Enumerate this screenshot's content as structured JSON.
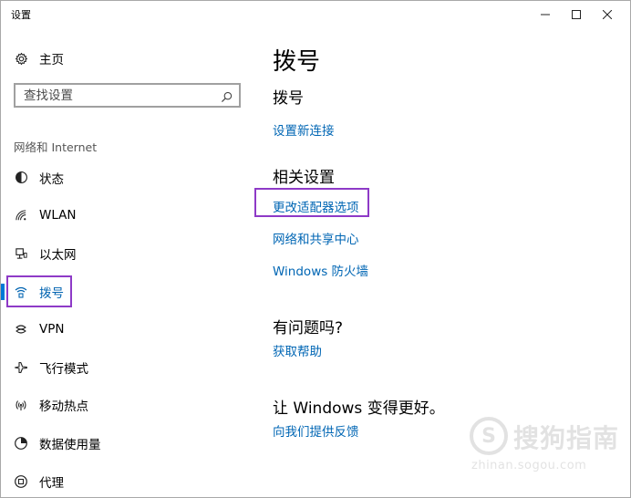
{
  "window": {
    "title": "设置"
  },
  "sidebar": {
    "home_label": "主页",
    "search_placeholder": "查找设置",
    "section_label": "网络和 Internet",
    "items": [
      {
        "label": "状态",
        "icon": "status-icon"
      },
      {
        "label": "WLAN",
        "icon": "wifi-icon"
      },
      {
        "label": "以太网",
        "icon": "ethernet-icon"
      },
      {
        "label": "拨号",
        "icon": "dialup-icon",
        "selected": true
      },
      {
        "label": "VPN",
        "icon": "vpn-icon"
      },
      {
        "label": "飞行模式",
        "icon": "airplane-icon"
      },
      {
        "label": "移动热点",
        "icon": "hotspot-icon"
      },
      {
        "label": "数据使用量",
        "icon": "data-usage-icon"
      },
      {
        "label": "代理",
        "icon": "proxy-icon"
      }
    ]
  },
  "main": {
    "page_title": "拨号",
    "dialup_heading": "拨号",
    "setup_link": "设置新连接",
    "related_heading": "相关设置",
    "related_links": [
      "更改适配器选项",
      "网络和共享中心",
      "Windows 防火墙"
    ],
    "question_heading": "有问题吗?",
    "help_link": "获取帮助",
    "improve_heading": "让 Windows 变得更好。",
    "feedback_link": "向我们提供反馈"
  },
  "watermark": {
    "logo_letter": "S",
    "brand_text": "搜狗指南",
    "url": "zhinan.sogou.com"
  },
  "colors": {
    "link": "#0066b4",
    "accent": "#0078d7",
    "highlight_box": "#8e3ac7"
  }
}
